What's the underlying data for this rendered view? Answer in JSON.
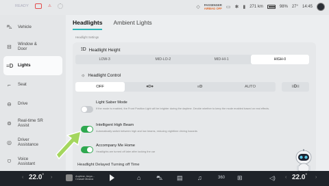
{
  "statusbar": {
    "ready": "READY",
    "passenger_airbag_line1": "PASSENGER",
    "passenger_airbag_line2": "AIRBAG OFF",
    "range": "271 km",
    "battery": "98%",
    "outside_temp": "27°",
    "time": "14:45"
  },
  "sidebar": {
    "items": [
      {
        "label": "Vehicle",
        "icon": "car-icon"
      },
      {
        "label": "Window & Door",
        "icon": "window-door-icon"
      },
      {
        "label": "Lights",
        "icon": "lights-icon",
        "active": true
      },
      {
        "label": "Seat",
        "icon": "seat-icon"
      },
      {
        "label": "Drive",
        "icon": "steering-wheel-icon"
      },
      {
        "label": "Real-time SR Assist",
        "icon": "sr-assist-icon"
      },
      {
        "label": "Driver Assistance",
        "icon": "driver-assistance-icon"
      },
      {
        "label": "Voice Assistant",
        "icon": "voice-assistant-icon"
      }
    ]
  },
  "tabs": [
    {
      "label": "Headlights",
      "active": true
    },
    {
      "label": "Ambient Lights",
      "active": false
    }
  ],
  "section_caption": "Headlight Settings",
  "headlight_height": {
    "title": "Headlight Height",
    "options": [
      "LOW-3",
      "MID-LO-2",
      "MID-HI-1",
      "HIGH-0"
    ],
    "selected": "HIGH-0"
  },
  "headlight_control": {
    "title": "Headlight Control",
    "options": [
      "OFF",
      "⦁D⦁",
      "≡D",
      "AUTO"
    ],
    "selected": "OFF",
    "extra_option": "≡D≡"
  },
  "toggles": [
    {
      "title": "Light Saber Mode",
      "description": "If the mode is enabled, the Front Position Light will be brighter during the daytime. Decide whether to keep the mode enabled based on real effects.",
      "on": false
    },
    {
      "title": "Intelligent High Beam",
      "description": "Automatically switch between high and low beams, reducing nighttime driving hazards",
      "on": true
    },
    {
      "title": "Accompany Me Home",
      "description": "Headlights are turned off later after locking the car",
      "on": true
    }
  ],
  "delayed_off_title": "Headlight Delayed Turning off Time",
  "bottombar": {
    "left_temp": "22.0",
    "right_temp": "22.0",
    "temp_unit": "°",
    "media_line1": "Anytime, Anyw...",
    "media_line2": "Ceasair Musica",
    "dock_360": "360"
  },
  "colors": {
    "accent": "#2bb6b8",
    "toggle_on": "#2ea84f",
    "airbag_off": "#e26b2b",
    "arrow": "#a4d65e"
  }
}
